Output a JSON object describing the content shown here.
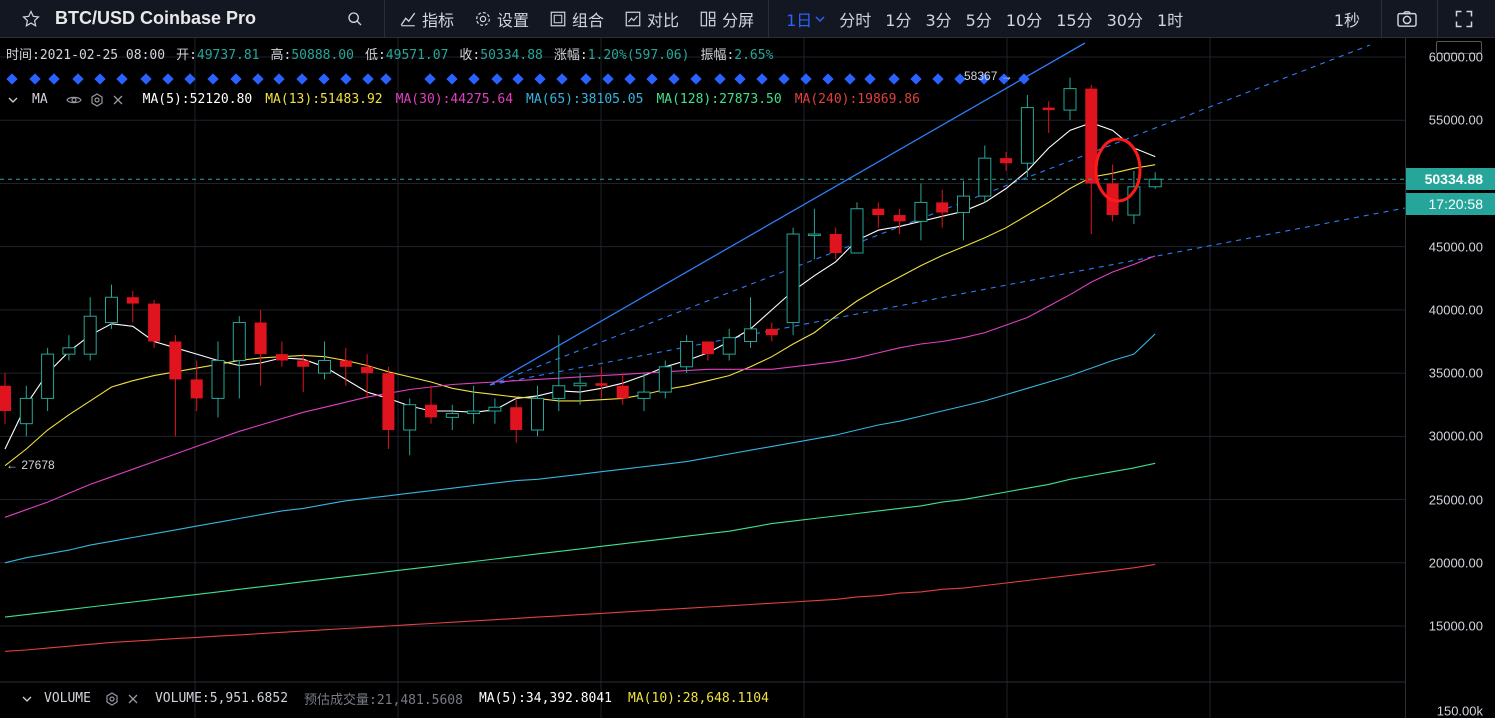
{
  "toolbar": {
    "symbol": "BTC/USD Coinbase Pro",
    "indicators": "指标",
    "settings": "设置",
    "combine": "组合",
    "compare": "对比",
    "split": "分屏",
    "timeframes": [
      "1日",
      "分时",
      "1分",
      "3分",
      "5分",
      "10分",
      "15分",
      "30分",
      "1时"
    ],
    "active_timeframe": "1日",
    "second": "1秒"
  },
  "ohlc": {
    "time_label": "时间:",
    "time": "2021-02-25 08:00",
    "open_label": "开:",
    "open": "49737.81",
    "high_label": "高:",
    "high": "50888.00",
    "low_label": "低:",
    "low": "49571.07",
    "close_label": "收:",
    "close": "50334.88",
    "change_label": "涨幅:",
    "change": "1.20%(597.06)",
    "amp_label": "振幅:",
    "amp": "2.65%"
  },
  "ma_legend": {
    "title": "MA",
    "ma5": "MA(5):52120.80",
    "ma13": "MA(13):51483.92",
    "ma30": "MA(30):44275.64",
    "ma65": "MA(65):38105.05",
    "ma128": "MA(128):27873.50",
    "ma240": "MA(240):19869.86"
  },
  "volume_legend": {
    "title": "VOLUME",
    "volume": "VOLUME:5,951.6852",
    "est_label": "预估成交量:",
    "est": "21,481.5608",
    "ma5": "MA(5):34,392.8041",
    "ma10": "MA(10):28,648.1104"
  },
  "price_axis": {
    "ticks": [
      "60000.00",
      "55000.00",
      "50000.00",
      "45000.00",
      "40000.00",
      "35000.00",
      "30000.00",
      "25000.00",
      "20000.00",
      "15000.00"
    ],
    "current_price": "50334.88",
    "countdown": "17:20:58",
    "volume_tick": "150.00k"
  },
  "annotations": {
    "high": "58367 →",
    "low": "← 27678"
  },
  "colors": {
    "up": "#26a69a",
    "down": "#e0141e",
    "ma5": "#ffffff",
    "ma13": "#f0e040",
    "ma30": "#e040c0",
    "ma65": "#36b5e0",
    "ma128": "#40e090",
    "ma240": "#e04040",
    "trend": "#2f7cf6"
  },
  "chart_data": {
    "type": "candlestick",
    "y_range": [
      10000,
      62000
    ],
    "candles": [
      [
        34000,
        35000,
        31000,
        32000
      ],
      [
        31000,
        34000,
        30000,
        33000
      ],
      [
        33000,
        37000,
        32000,
        36500
      ],
      [
        36500,
        38000,
        36000,
        37000
      ],
      [
        36500,
        41000,
        36000,
        39500
      ],
      [
        39000,
        42000,
        38500,
        41000
      ],
      [
        41000,
        41500,
        39000,
        40500
      ],
      [
        40500,
        40800,
        37000,
        37500
      ],
      [
        37500,
        38000,
        30000,
        34500
      ],
      [
        34500,
        36000,
        32000,
        33000
      ],
      [
        33000,
        37500,
        31500,
        36000
      ],
      [
        36000,
        39500,
        33000,
        39000
      ],
      [
        39000,
        40000,
        34000,
        36500
      ],
      [
        36500,
        37500,
        35500,
        36000
      ],
      [
        36000,
        36500,
        33500,
        35500
      ],
      [
        35000,
        37500,
        34500,
        36000
      ],
      [
        36000,
        37000,
        34000,
        35500
      ],
      [
        35500,
        36500,
        33000,
        35000
      ],
      [
        35000,
        35500,
        29000,
        30500
      ],
      [
        30500,
        33000,
        28500,
        32500
      ],
      [
        32500,
        34000,
        31000,
        31500
      ],
      [
        31500,
        32500,
        30500,
        31800
      ],
      [
        31800,
        34000,
        31000,
        32000
      ],
      [
        32000,
        33000,
        31000,
        32300
      ],
      [
        32300,
        33000,
        29500,
        30500
      ],
      [
        30500,
        34000,
        30000,
        33000
      ],
      [
        33000,
        38000,
        32000,
        34000
      ],
      [
        34000,
        35000,
        32500,
        34200
      ],
      [
        34200,
        35500,
        33000,
        34000
      ],
      [
        34000,
        35000,
        32500,
        33000
      ],
      [
        33000,
        35000,
        32000,
        33500
      ],
      [
        33500,
        36000,
        33000,
        35500
      ],
      [
        35500,
        38000,
        35000,
        37500
      ],
      [
        37500,
        37500,
        36000,
        36500
      ],
      [
        36500,
        38500,
        36000,
        37800
      ],
      [
        37500,
        41000,
        37000,
        38500
      ],
      [
        38500,
        39000,
        37500,
        38000
      ],
      [
        39000,
        46500,
        38000,
        46000
      ],
      [
        46000,
        48000,
        44000,
        46000
      ],
      [
        46000,
        46500,
        44000,
        44500
      ],
      [
        44500,
        48500,
        44500,
        48000
      ],
      [
        48000,
        48500,
        46500,
        47500
      ],
      [
        47500,
        48000,
        46000,
        47000
      ],
      [
        47000,
        50000,
        45500,
        48500
      ],
      [
        48500,
        49500,
        46500,
        47700
      ],
      [
        47700,
        50200,
        45500,
        49000
      ],
      [
        49000,
        53000,
        48500,
        52000
      ],
      [
        52000,
        52500,
        51000,
        51600
      ],
      [
        51600,
        57000,
        50500,
        56000
      ],
      [
        56000,
        56500,
        54000,
        55800
      ],
      [
        55800,
        58367,
        55000,
        57500
      ],
      [
        57500,
        57800,
        46000,
        50000
      ],
      [
        50000,
        51500,
        47000,
        47500
      ],
      [
        47500,
        51000,
        46800,
        49737
      ],
      [
        49737,
        50888,
        49571,
        50334
      ]
    ],
    "ma": {
      "ma5": [
        29000,
        32500,
        35000,
        36700,
        38000,
        38900,
        38700,
        37500,
        37000,
        36500,
        36000,
        35600,
        35800,
        36200,
        36100,
        35500,
        34500,
        33500,
        33000,
        32400,
        32000,
        32000,
        31900,
        32100,
        33000,
        33200,
        33600,
        33500,
        33800,
        34200,
        34800,
        35500,
        36000,
        36600,
        37500,
        38500,
        40000,
        41500,
        42700,
        43800,
        45500,
        46300,
        46600,
        47000,
        47400,
        47800,
        48500,
        49600,
        51000,
        52800,
        54200,
        54800,
        54200,
        52800,
        52120
      ],
      "ma13": [
        27678,
        29000,
        30500,
        31700,
        32800,
        33900,
        34400,
        34800,
        35100,
        35400,
        35700,
        36000,
        36200,
        36300,
        36400,
        36300,
        36000,
        35600,
        35100,
        34700,
        34300,
        33800,
        33500,
        33300,
        33100,
        33000,
        32800,
        32800,
        32900,
        33000,
        33300,
        33700,
        34000,
        34400,
        34800,
        35500,
        36300,
        37300,
        38200,
        39500,
        40700,
        41700,
        42600,
        43500,
        44300,
        45000,
        45700,
        46500,
        47500,
        48500,
        49600,
        50500,
        50800,
        51200,
        51480
      ],
      "ma30": [
        23600,
        24200,
        24800,
        25500,
        26200,
        26800,
        27400,
        28000,
        28600,
        29200,
        29800,
        30400,
        30900,
        31400,
        31900,
        32300,
        32700,
        33100,
        33400,
        33700,
        33900,
        34100,
        34200,
        34300,
        34400,
        34500,
        34600,
        34700,
        34800,
        34900,
        35000,
        35100,
        35200,
        35300,
        35300,
        35300,
        35300,
        35500,
        35700,
        35900,
        36200,
        36600,
        37000,
        37300,
        37500,
        37800,
        38200,
        38800,
        39400,
        40300,
        41200,
        42200,
        43000,
        43600,
        44270
      ],
      "ma65": [
        20000,
        20400,
        20700,
        21000,
        21400,
        21700,
        22000,
        22300,
        22600,
        22900,
        23200,
        23500,
        23800,
        24100,
        24300,
        24600,
        24900,
        25100,
        25300,
        25500,
        25700,
        25900,
        26100,
        26300,
        26500,
        26600,
        26800,
        27000,
        27200,
        27400,
        27600,
        27800,
        28000,
        28300,
        28600,
        28900,
        29200,
        29500,
        29800,
        30100,
        30500,
        30900,
        31200,
        31600,
        32000,
        32400,
        32800,
        33300,
        33800,
        34300,
        34800,
        35400,
        36000,
        36500,
        38100
      ],
      "ma128": [
        15700,
        15900,
        16100,
        16300,
        16500,
        16700,
        16900,
        17100,
        17300,
        17500,
        17700,
        17900,
        18100,
        18300,
        18500,
        18700,
        18900,
        19100,
        19300,
        19500,
        19700,
        19900,
        20100,
        20300,
        20500,
        20700,
        20900,
        21100,
        21300,
        21500,
        21700,
        21900,
        22100,
        22300,
        22500,
        22800,
        23100,
        23300,
        23500,
        23700,
        23900,
        24100,
        24300,
        24500,
        24800,
        25000,
        25300,
        25600,
        25900,
        26200,
        26600,
        26900,
        27200,
        27500,
        27870
      ],
      "ma240": [
        13000,
        13100,
        13250,
        13400,
        13550,
        13700,
        13800,
        13900,
        14000,
        14100,
        14200,
        14300,
        14400,
        14500,
        14600,
        14700,
        14800,
        14900,
        15000,
        15100,
        15200,
        15300,
        15400,
        15500,
        15600,
        15700,
        15800,
        15900,
        16000,
        16100,
        16200,
        16300,
        16400,
        16500,
        16600,
        16700,
        16800,
        16900,
        17000,
        17100,
        17300,
        17400,
        17600,
        17700,
        17900,
        18000,
        18200,
        18400,
        18600,
        18800,
        19000,
        19200,
        19400,
        19600,
        19870
      ]
    }
  }
}
